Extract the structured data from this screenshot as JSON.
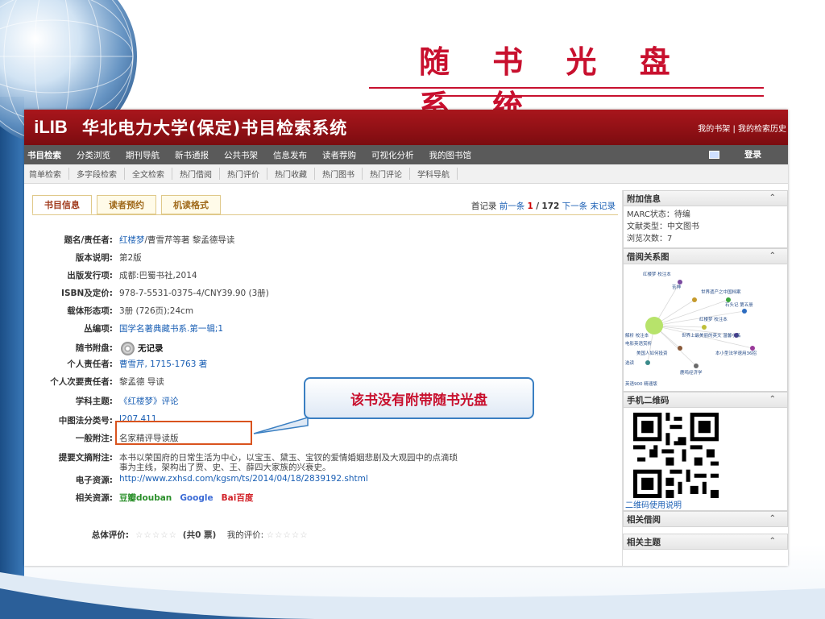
{
  "slide": {
    "title": "随 书 光 盘 系 统"
  },
  "app": {
    "logo_text": "iLIB",
    "system_title": "华北电力大学(保定)书目检索系统",
    "top_links": "我的书架 | 我的检索历史",
    "nav_items": [
      "书目检索",
      "分类浏览",
      "期刊导航",
      "新书通报",
      "公共书架",
      "信息发布",
      "读者荐购",
      "可视化分析",
      "我的图书馆"
    ],
    "login_label": "登录",
    "subnav_items": [
      "简单检索",
      "多字段检索",
      "全文检索",
      "热门借阅",
      "热门评价",
      "热门收藏",
      "热门图书",
      "热门评论",
      "学科导航"
    ]
  },
  "record": {
    "tabs": [
      "书目信息",
      "读者预约",
      "机读格式"
    ],
    "nav": {
      "first": "首记录",
      "prev": "前一条",
      "current": "1",
      "sep": "/",
      "total": "172",
      "next": "下一条",
      "last": "末记录"
    },
    "fields": [
      {
        "label": "题名/责任者:",
        "value": "红楼梦/曹雪芹等著 黎孟德导读",
        "link_part": "红楼梦"
      },
      {
        "label": "版本说明:",
        "value": "第2版"
      },
      {
        "label": "出版发行项:",
        "value": "成都:巴蜀书社,2014"
      },
      {
        "label": "ISBN及定价:",
        "value": "978-7-5531-0375-4/CNY39.90 (3册)"
      },
      {
        "label": "载体形态项:",
        "value": "3册 (726页);24cm"
      },
      {
        "label": "丛编项:",
        "value": "国学名著典藏书系.第一辑;1"
      },
      {
        "label": "随书附盘:",
        "value": "无记录"
      },
      {
        "label": "个人责任者:",
        "value": "曹雪芹, 1715-1763 著"
      },
      {
        "label": "个人次要责任者:",
        "value": "黎孟德 导读"
      },
      {
        "label": "学科主题:",
        "value": "《红楼梦》评论"
      },
      {
        "label": "中图法分类号:",
        "value": "I207.411"
      },
      {
        "label": "一般附注:",
        "value": "名家精评导读版"
      },
      {
        "label": "提要文摘附注:",
        "value": "本书以荣国府的日常生活为中心，以宝玉、黛玉、宝钗的爱情婚姻悲剧及大观园中的点滴琐",
        "value2": "事为主线，架构出了贾、史、王、薛四大家族的兴衰史。"
      },
      {
        "label": "电子资源:",
        "value": "http://www.zxhsd.com/kgsm/ts/2014/04/18/2839192.shtml"
      },
      {
        "label": "相关资源:",
        "douban": "豆瓣douban",
        "google": "Google",
        "baidu": "Bai百度"
      }
    ],
    "rating_label": "总体评价:",
    "rating_count": "(共0 票)",
    "my_rating_label": "我的评价:",
    "stars": "☆☆☆☆☆",
    "callout": "该书没有附带随书光盘"
  },
  "sidebar": {
    "extra_title": "附加信息",
    "extra_lines": [
      "MARC状态：待编",
      "文献类型：中文图书",
      "浏览次数：7"
    ],
    "graph_title": "借阅关系图",
    "graph_labels": [
      "红楼梦 校注本",
      "苦神",
      "世界遗产之中国档案",
      "石头记 第五册",
      "红楼梦 校注本",
      "解析 校注本",
      "世界上最美丽的英文 温馨小品",
      "电影英语赏析",
      "美国人如何投资",
      "本小型法学速用36招",
      "选读",
      "鹿鸣经济学",
      "英语900 精速版"
    ],
    "qr_title": "手机二维码",
    "qr_help": "二维码使用说明",
    "related_borrow": "相关借阅",
    "related_subject": "相关主题",
    "chevron": "⌃"
  }
}
